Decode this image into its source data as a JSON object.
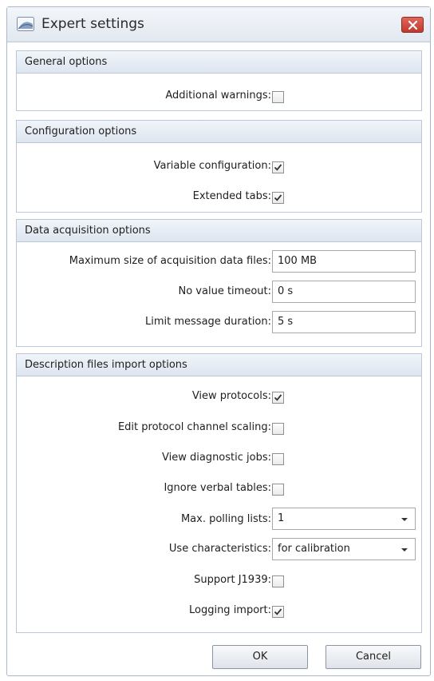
{
  "window": {
    "title": "Expert settings"
  },
  "general": {
    "header": "General options",
    "additional_warnings": {
      "label": "Additional warnings:",
      "checked": false
    }
  },
  "configuration": {
    "header": "Configuration options",
    "variable_configuration": {
      "label": "Variable configuration:",
      "checked": true
    },
    "extended_tabs": {
      "label": "Extended tabs:",
      "checked": true
    }
  },
  "acquisition": {
    "header": "Data acquisition options",
    "max_size": {
      "label": "Maximum size of acquisition data files:",
      "value": "100 MB"
    },
    "no_value_timeout": {
      "label": "No value timeout:",
      "value": "0 s"
    },
    "limit_message_duration": {
      "label": "Limit message duration:",
      "value": "5 s"
    }
  },
  "import": {
    "header": "Description files import options",
    "view_protocols": {
      "label": "View protocols:",
      "checked": true
    },
    "edit_protocol_scaling": {
      "label": "Edit protocol channel scaling:",
      "checked": false
    },
    "view_diagnostic_jobs": {
      "label": "View diagnostic jobs:",
      "checked": false
    },
    "ignore_verbal_tables": {
      "label": "Ignore verbal tables:",
      "checked": false
    },
    "max_polling_lists": {
      "label": "Max. polling lists:",
      "value": "1"
    },
    "use_characteristics": {
      "label": "Use characteristics:",
      "value": "for calibration"
    },
    "support_j1939": {
      "label": "Support J1939:",
      "checked": false
    },
    "logging_import": {
      "label": "Logging import:",
      "checked": true
    }
  },
  "buttons": {
    "ok": "OK",
    "cancel": "Cancel"
  },
  "colors": {
    "accent_border": "#b9c7d9",
    "close_button": "#c9473b"
  },
  "icons": {
    "app": "window-app-icon",
    "close": "close-icon",
    "check": "checkmark-icon",
    "dropdown": "chevron-down-icon"
  }
}
